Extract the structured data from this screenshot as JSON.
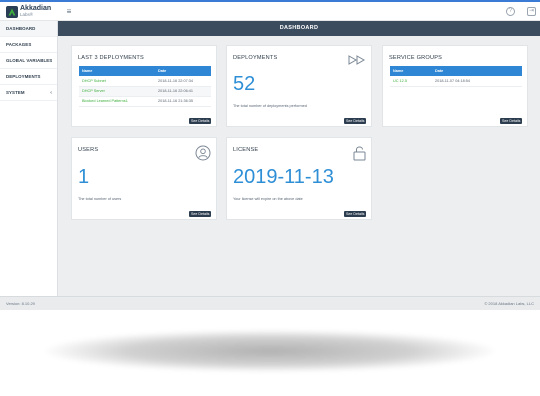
{
  "app": {
    "brand": "Akkadian",
    "brand_sub": "Labs®",
    "menu_toggle_glyph": "≡",
    "help_glyph": "?",
    "logout_glyph": "⇥",
    "accent_color": "#2e86d4",
    "header_color": "#3b4c5e"
  },
  "sidebar": {
    "items": [
      {
        "label": "DASHBOARD",
        "active": true
      },
      {
        "label": "PACKAGES"
      },
      {
        "label": "GLOBAL VARIABLES"
      },
      {
        "label": "DEPLOYMENTS"
      },
      {
        "label": "SYSTEM",
        "has_children": true,
        "chevron": "‹"
      }
    ]
  },
  "header": {
    "title": "DASHBOARD"
  },
  "cards": {
    "last_deployments": {
      "title": "LAST 3 DEPLOYMENTS",
      "columns": [
        "Name",
        "Date"
      ],
      "rows": [
        {
          "name": "DHCP Subnet",
          "date": "2018-11-16 22:07:34"
        },
        {
          "name": "DHCP Server",
          "date": "2018-11-16 22:06:41"
        },
        {
          "name": "Blocked Learned Patterns1",
          "date": "2018-11-16 21:36:35"
        }
      ],
      "button": "See Details"
    },
    "deployments": {
      "title": "DEPLOYMENTS",
      "value": "52",
      "description": "The total number of deployments performed",
      "button": "See Details",
      "icon": "fast-forward-icon"
    },
    "service_groups": {
      "title": "SERVICE GROUPS",
      "columns": [
        "Name",
        "Date"
      ],
      "rows": [
        {
          "name": "UC 12.5",
          "date": "2018-11-07 04:18:54"
        }
      ],
      "button": "See Details"
    },
    "users": {
      "title": "USERS",
      "value": "1",
      "description": "The total number of users",
      "button": "See Details",
      "icon": "user-icon"
    },
    "license": {
      "title": "LICENSE",
      "value": "2019-11-13",
      "description": "Your license will expire on the above date",
      "button": "See Details",
      "icon": "lock-icon"
    }
  },
  "footer": {
    "version": "Version: 8.10.29",
    "copyright": "© 2018 Akkadian Labs, LLC"
  }
}
